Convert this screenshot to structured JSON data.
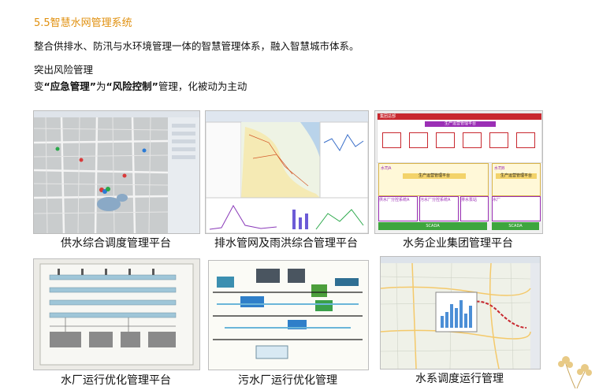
{
  "heading": "5.5智慧水网管理系统",
  "intro": "整合供排水、防汛与水环境管理一体的智慧管理体系，融入智慧城市体系。",
  "subtitle": "突出风险管理",
  "statement": {
    "prefix": "变",
    "q1": "“应急管理”",
    "mid": "为",
    "q2": "“风险控制”",
    "suffix": "管理，化被动为主动"
  },
  "panels": [
    {
      "caption": "供水综合调度管理平台",
      "icon": "water-supply-map-screenshot"
    },
    {
      "caption": "排水管网及雨洪综合管理平台",
      "icon": "drainage-gis-screenshot"
    },
    {
      "caption": "水务企业集团管理平台",
      "icon": "group-architecture-diagram"
    },
    {
      "caption": "水厂运行优化管理平台",
      "icon": "water-plant-scada-screenshot"
    },
    {
      "caption": "污水厂运行优化管理",
      "icon": "sewage-plant-scada-screenshot"
    },
    {
      "caption": "水系调度运行管理",
      "icon": "river-dispatch-map-screenshot"
    }
  ],
  "diagram_labels": {
    "sys_header": "集团总部",
    "platform": "生产运营管理平台",
    "water_a": "水司A",
    "water_b": "水司B",
    "water_a_platform": "生产运营管理平台",
    "water_b_platform": "生产运营管理平台",
    "supply_system": "供水厂分控系统A",
    "sewage_system": "污水厂分控系统A",
    "pump_station": "排水泵站",
    "water_plant": "水厂",
    "scada_a": "SCADA",
    "scada_b": "SCADA"
  },
  "colors": {
    "heading": "#e0900f",
    "diagram_purple": "#9b2fb5",
    "diagram_red": "#c8282f"
  }
}
